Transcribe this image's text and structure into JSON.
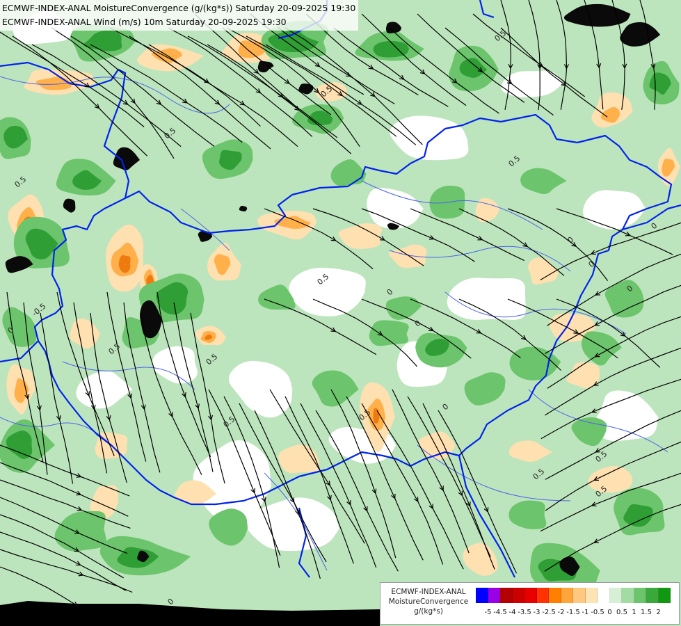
{
  "header": {
    "line1": "ECMWF-INDEX-ANAL MoistureConvergence (g/(kg*s)) Saturday 20-09-2025 19:30",
    "line2": "ECMWF-INDEX-ANAL Wind (m/s) 10m Saturday 20-09-2025 19:30"
  },
  "legend": {
    "line1": "ECMWF-INDEX-ANAL",
    "line2": "MoistureConvergence",
    "line3": "g/(kg*s)",
    "colors": [
      "#0000ff",
      "#9a00e6",
      "#b30000",
      "#cc0000",
      "#e80000",
      "#ff3300",
      "#ff7f00",
      "#ffa53c",
      "#ffc880",
      "#ffe4b3",
      "#ffffff",
      "#d5f0d5",
      "#a3dca3",
      "#6cc46c",
      "#3aa83a",
      "#109810"
    ],
    "labels": [
      "-5",
      "-4.5",
      "-4",
      "-3.5",
      "-3",
      "-2.5",
      "-2",
      "-1.5",
      "-1",
      "-0.5",
      "0",
      "0.5",
      "1",
      "1.5",
      "2"
    ]
  },
  "map": {
    "contour_labels": [
      "0.5",
      "0",
      "-0.5"
    ],
    "field_colors": {
      "strong_convergence": "#0a0a0a",
      "convergence_high": "#2e9e35",
      "convergence_mid": "#6cc46c",
      "convergence_low": "#bde5bd",
      "neutral": "#ffffff",
      "divergence_low": "#ffe0b0",
      "divergence_mid": "#ffb04a",
      "divergence_high": "#ee7a10",
      "border": "#0022ee",
      "river": "#4a62ee",
      "streamline": "#000000",
      "out_of_domain": "#000000"
    }
  }
}
